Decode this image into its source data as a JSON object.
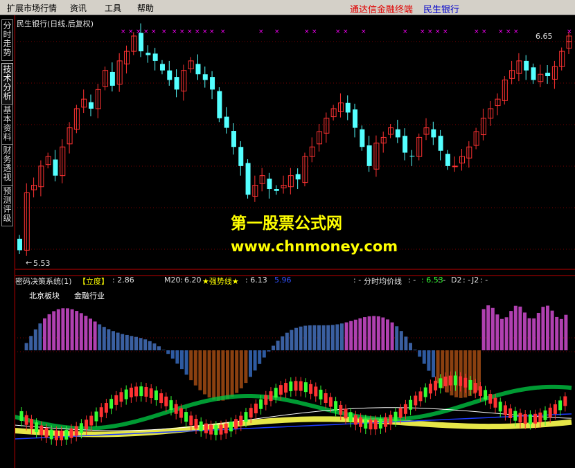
{
  "menu": {
    "items": [
      "扩展市场行情",
      "资讯",
      "工具",
      "帮助"
    ]
  },
  "brand": {
    "left": "通达信金融终端",
    "right": "民生银行"
  },
  "tabs": [
    "分时走势",
    "技术分析",
    "基本资料",
    "财务透视",
    "预测评级"
  ],
  "main_panel": {
    "title": "民生银行(日线,后复权)",
    "price_high": "6.65",
    "price_low": "5.53"
  },
  "indicator_panel": {
    "name": "密码决策系统(1)",
    "lidu_label": "【立度】",
    "lidu_value": ": 2.86",
    "m20_label": "M20:",
    "m20_value": "6.20",
    "strong_label": "★强势线★",
    "strong_value": ": 6.13",
    "blue_value": "5.96",
    "fenshi_prefix": ": -",
    "fenshi_label": "分时均价线",
    "fenshi_mid": ": -",
    "fenshi_value": ": 6.53",
    "d2_prefix": ": -",
    "d2_label": "D2",
    "d2_value": ": -",
    "j2_label": "J2",
    "j2_value": ": -",
    "sector": "北京板块",
    "industry": "金融行业"
  },
  "watermark": {
    "line1": "第一股票公式网",
    "line2": "www.chnmoney.com"
  },
  "colors": {
    "up": "#ff3232",
    "down": "#54ffff",
    "marker": "#ff00ff",
    "yellow": "#ffff00",
    "blue": "#1e3cff"
  },
  "chart_data": [
    {
      "type": "candlestick",
      "title": "民生银行(日线,后复权)",
      "series": [
        {
          "name": "民生银行",
          "close": [
            5.56,
            5.86,
            5.9,
            6.0,
            6.05,
            5.95,
            6.1,
            6.2,
            6.3,
            6.35,
            6.3,
            6.4,
            6.5,
            6.42,
            6.55,
            6.6,
            6.68,
            6.6,
            6.58,
            6.55,
            6.5,
            6.45,
            6.4,
            6.5,
            6.55,
            6.48,
            6.45,
            6.4,
            6.25,
            6.2,
            6.1,
            6.0,
            5.85,
            5.9,
            5.95,
            5.88,
            5.87,
            5.9,
            5.95,
            5.93,
            6.05,
            6.1,
            6.18,
            6.25,
            6.3,
            6.33,
            6.28,
            6.2,
            6.1,
            6.0,
            6.12,
            6.15,
            6.2,
            6.15,
            6.07,
            6.05,
            6.15,
            6.2,
            6.15,
            6.08,
            6.0,
            6.0,
            6.05,
            6.1,
            6.18,
            6.25,
            6.3,
            6.35,
            6.45,
            6.5,
            6.55,
            6.5,
            6.45,
            6.48,
            6.47,
            6.52,
            6.6,
            6.65
          ]
        }
      ],
      "ylabel_high": "6.65",
      "ylabel_low": "5.53"
    },
    {
      "type": "area",
      "title": "密码决策系统(1)",
      "series": [
        {
          "name": "M20",
          "last": 6.2
        },
        {
          "name": "★强势线★",
          "last": 6.13
        },
        {
          "name": "【立度】",
          "last": 2.86
        }
      ]
    }
  ]
}
